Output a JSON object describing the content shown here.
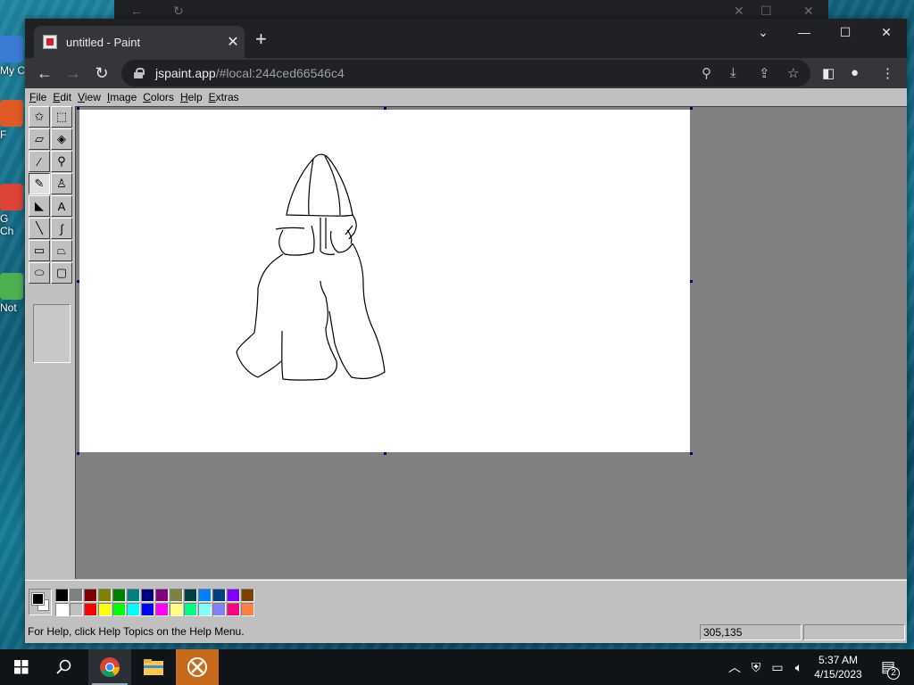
{
  "desktop": {
    "icons": [
      {
        "label": "My C",
        "color": "#3a7bd5"
      },
      {
        "label": "F",
        "color": "#e05a28"
      },
      {
        "label": "G\nCh",
        "color": "#db4437"
      },
      {
        "label": "Not",
        "color": "#4caf50"
      }
    ]
  },
  "browser": {
    "tab_title": "untitled - Paint",
    "url_host": "jspaint.app",
    "url_rest": "/#local:244ced66546c4"
  },
  "paint": {
    "menus": [
      {
        "u": "F",
        "rest": "ile"
      },
      {
        "u": "E",
        "rest": "dit"
      },
      {
        "u": "V",
        "rest": "iew"
      },
      {
        "u": "I",
        "rest": "mage"
      },
      {
        "u": "C",
        "rest": "olors"
      },
      {
        "u": "H",
        "rest": "elp"
      },
      {
        "u": "E",
        "rest": "xtras"
      }
    ],
    "tools": [
      {
        "name": "free-form-select-tool",
        "glyph": "✩"
      },
      {
        "name": "select-tool",
        "glyph": "⬚"
      },
      {
        "name": "eraser-tool",
        "glyph": "▱"
      },
      {
        "name": "fill-tool",
        "glyph": "◈"
      },
      {
        "name": "pick-color-tool",
        "glyph": "⁄"
      },
      {
        "name": "magnifier-tool",
        "glyph": "⚲"
      },
      {
        "name": "pencil-tool",
        "glyph": "✎",
        "selected": true
      },
      {
        "name": "brush-tool",
        "glyph": "♙"
      },
      {
        "name": "airbrush-tool",
        "glyph": "◣"
      },
      {
        "name": "text-tool",
        "glyph": "A"
      },
      {
        "name": "line-tool",
        "glyph": "╲"
      },
      {
        "name": "curve-tool",
        "glyph": "∫"
      },
      {
        "name": "rectangle-tool",
        "glyph": "▭"
      },
      {
        "name": "polygon-tool",
        "glyph": "⏢"
      },
      {
        "name": "ellipse-tool",
        "glyph": "⬭"
      },
      {
        "name": "rounded-rectangle-tool",
        "glyph": "▢"
      }
    ],
    "foreground_color": "#000000",
    "background_color": "#ffffff",
    "palette": [
      "#000000",
      "#808080",
      "#800000",
      "#808000",
      "#008000",
      "#008080",
      "#000080",
      "#800080",
      "#808040",
      "#004040",
      "#0080ff",
      "#004080",
      "#8000ff",
      "#804000",
      "#ffffff",
      "#c0c0c0",
      "#ff0000",
      "#ffff00",
      "#00ff00",
      "#00ffff",
      "#0000ff",
      "#ff00ff",
      "#ffff80",
      "#00ff80",
      "#80ffff",
      "#8080ff",
      "#ff0080",
      "#ff8040"
    ],
    "status_text": "For Help, click Help Topics on the Help Menu.",
    "cursor_position": "305,135",
    "selection_size": ""
  },
  "taskbar": {
    "time": "5:37 AM",
    "date": "4/15/2023",
    "notification_count": "2"
  }
}
